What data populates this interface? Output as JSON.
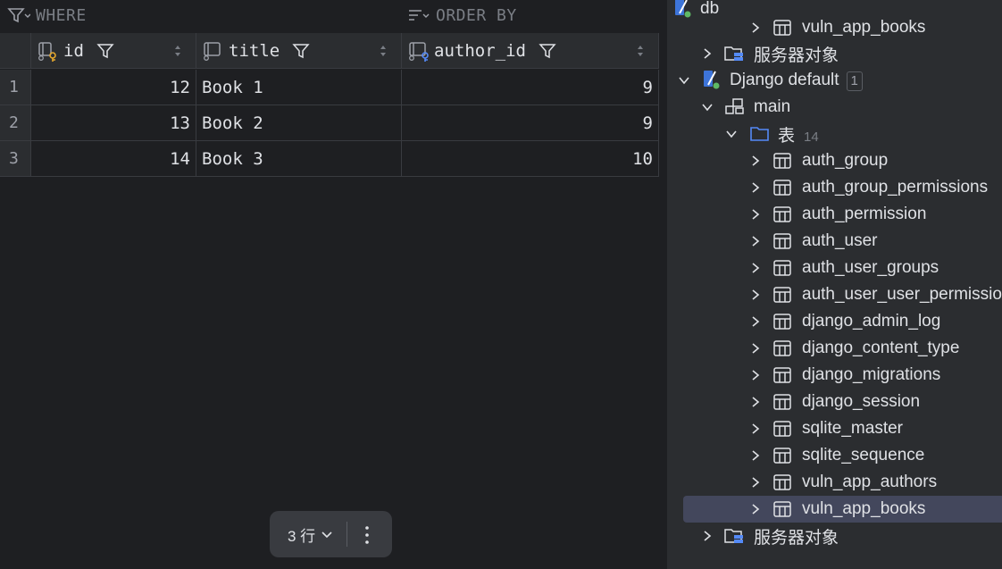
{
  "filter": {
    "where": "WHERE",
    "order_by": "ORDER BY"
  },
  "table": {
    "columns": [
      "id",
      "title",
      "author_id"
    ],
    "rows": [
      {
        "n": "1",
        "id": "12",
        "title": "Book 1",
        "author_id": "9"
      },
      {
        "n": "2",
        "id": "13",
        "title": "Book 2",
        "author_id": "9"
      },
      {
        "n": "3",
        "id": "14",
        "title": "Book 3",
        "author_id": "10"
      }
    ]
  },
  "status": {
    "rows": "3 行"
  },
  "tree": {
    "db": "db",
    "partial_table": "vuln_app_books",
    "server_objects_1": "服务器对象",
    "datasource": "Django default",
    "datasource_badge": "1",
    "schema": "main",
    "folder": "表",
    "folder_count": "14",
    "tables": [
      "auth_group",
      "auth_group_permissions",
      "auth_permission",
      "auth_user",
      "auth_user_groups",
      "auth_user_user_permissions",
      "django_admin_log",
      "django_content_type",
      "django_migrations",
      "django_session",
      "sqlite_master",
      "sqlite_sequence",
      "vuln_app_authors",
      "vuln_app_books"
    ],
    "selected_index": 13,
    "server_objects_2": "服务器对象"
  },
  "colors": {
    "accent_blue": "#548af7",
    "selection": "#43475c",
    "green_dot": "#5fb865"
  }
}
